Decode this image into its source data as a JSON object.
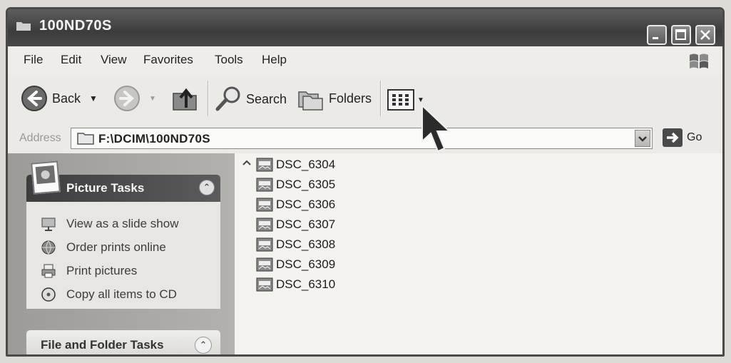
{
  "window": {
    "title": "100ND70S"
  },
  "menu": [
    "File",
    "Edit",
    "View",
    "Favorites",
    "Tools",
    "Help"
  ],
  "toolbar": {
    "back_label": "Back",
    "search_label": "Search",
    "folders_label": "Folders"
  },
  "address": {
    "label": "Address",
    "path": "F:\\DCIM\\100ND70S",
    "go_label": "Go"
  },
  "picture_tasks": {
    "title": "Picture Tasks",
    "items": [
      {
        "label": "View as a slide show",
        "icon": "slideshow-icon"
      },
      {
        "label": "Order prints online",
        "icon": "globe-icon"
      },
      {
        "label": "Print pictures",
        "icon": "printer-icon"
      },
      {
        "label": "Copy all items to CD",
        "icon": "cd-icon"
      }
    ]
  },
  "file_folder_tasks": {
    "title": "File and Folder Tasks"
  },
  "files": [
    "DSC_6304",
    "DSC_6305",
    "DSC_6306",
    "DSC_6307",
    "DSC_6308",
    "DSC_6309",
    "DSC_6310"
  ]
}
